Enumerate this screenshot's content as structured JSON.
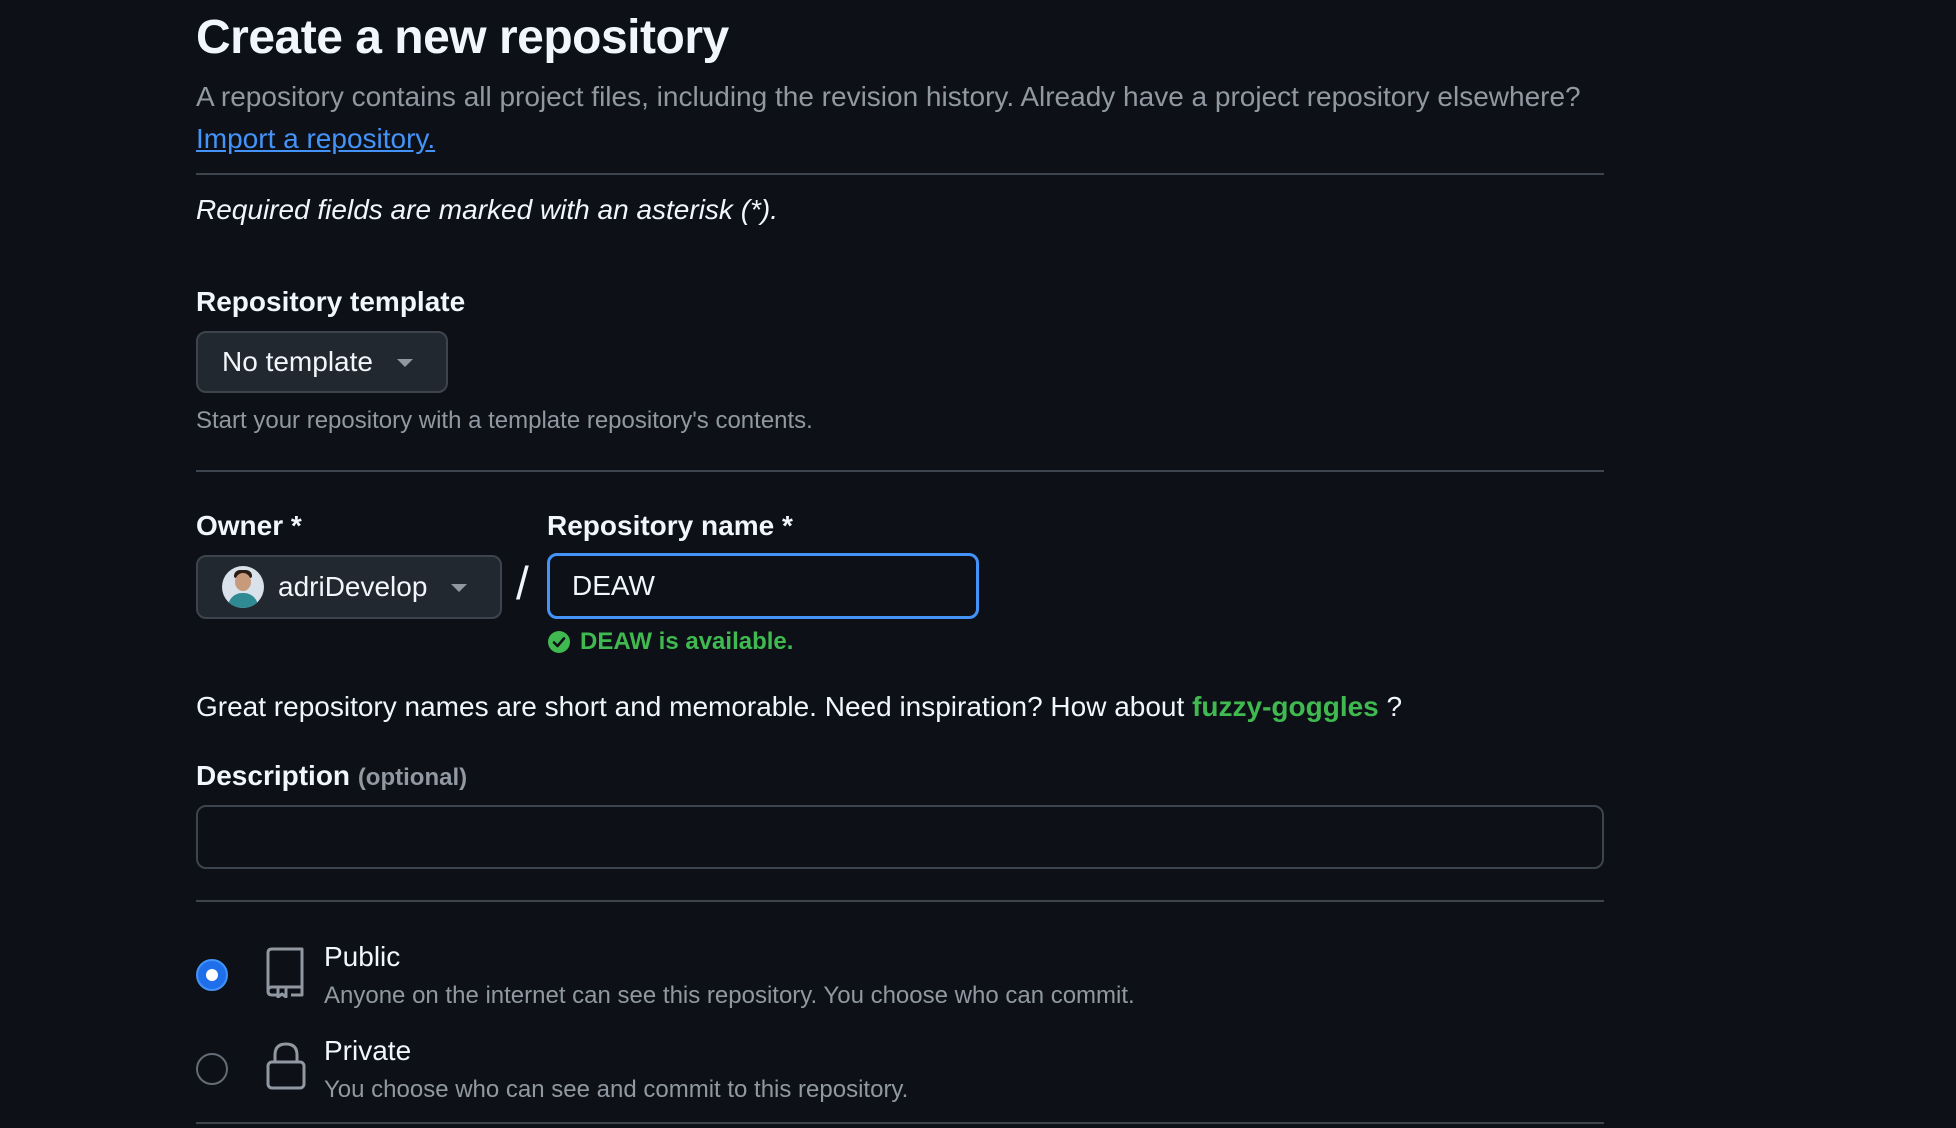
{
  "header": {
    "title": "Create a new repository",
    "subtitle": "A repository contains all project files, including the revision history. Already have a project repository elsewhere?",
    "import_link": "Import a repository."
  },
  "required_note": "Required fields are marked with an asterisk (*).",
  "template": {
    "label": "Repository template",
    "selected": "No template",
    "hint": "Start your repository with a template repository's contents."
  },
  "owner": {
    "label": "Owner *",
    "selected": "adriDevelop"
  },
  "separator": "/",
  "repo_name": {
    "label": "Repository name *",
    "value": "DEAW",
    "availability": "DEAW is available."
  },
  "inspiration": {
    "text": "Great repository names are short and memorable. Need inspiration? How about",
    "suggestion": "fuzzy-goggles",
    "suffix": "?"
  },
  "description": {
    "label": "Description",
    "optional": "(optional)",
    "value": ""
  },
  "visibility": {
    "selected": "Public",
    "options": [
      {
        "title": "Public",
        "desc": "Anyone on the internet can see this repository. You choose who can commit.",
        "icon": "repo-icon"
      },
      {
        "title": "Private",
        "desc": "You choose who can see and commit to this repository.",
        "icon": "lock-icon"
      }
    ]
  },
  "colors": {
    "background": "#0d1117",
    "link": "#4493f8",
    "success": "#3fb950",
    "focus_border": "#4493f8"
  }
}
